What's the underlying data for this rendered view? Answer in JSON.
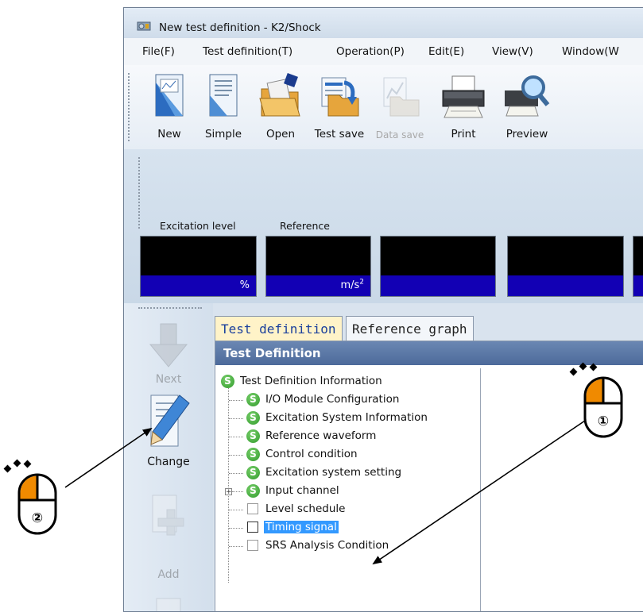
{
  "window": {
    "title": "New test definition - K2/Shock"
  },
  "menu": [
    "File(F)",
    "Test definition(T)",
    "Operation(P)",
    "Edit(E)",
    "View(V)",
    "Window(W"
  ],
  "toolbar": [
    {
      "label": "New",
      "icon": "new-document-icon",
      "enabled": true
    },
    {
      "label": "Simple",
      "icon": "simple-document-icon",
      "enabled": true
    },
    {
      "label": "Open",
      "icon": "open-folder-icon",
      "enabled": true
    },
    {
      "label": "Test save",
      "icon": "test-save-icon",
      "enabled": true
    },
    {
      "label": "Data save",
      "icon": "data-save-icon",
      "enabled": false
    },
    {
      "label": "Print",
      "icon": "printer-icon",
      "enabled": true
    },
    {
      "label": "Preview",
      "icon": "print-preview-icon",
      "enabled": true
    }
  ],
  "meters": {
    "excitation_title": "Excitation level",
    "reference_title": "Reference",
    "excitation_unit": "%",
    "reference_unit": "m/s",
    "reference_unit_sup": "2"
  },
  "side": {
    "next": "Next",
    "change": "Change",
    "add": "Add"
  },
  "tabs": {
    "active": "Test definition",
    "graph": "Reference graph"
  },
  "pane_header": "Test Definition",
  "tree": {
    "root": "Test Definition Information",
    "items": [
      {
        "label": "I/O Module Configuration",
        "type": "s"
      },
      {
        "label": "Excitation System Information",
        "type": "s"
      },
      {
        "label": "Reference waveform",
        "type": "s"
      },
      {
        "label": "Control condition",
        "type": "s"
      },
      {
        "label": "Excitation system setting",
        "type": "s"
      },
      {
        "label": "Input channel",
        "type": "s",
        "expandable": true
      },
      {
        "label": "Level schedule",
        "type": "box"
      },
      {
        "label": "Timing signal",
        "type": "box",
        "selected": true
      },
      {
        "label": "SRS Analysis Condition",
        "type": "box"
      }
    ],
    "s_glyph": "S"
  },
  "callouts": {
    "one": "①",
    "two": "②"
  },
  "colors": {
    "meter_unit_bg": "#1200b4",
    "selected_row": "#3399ff",
    "mouse_button": "#f08a00"
  }
}
